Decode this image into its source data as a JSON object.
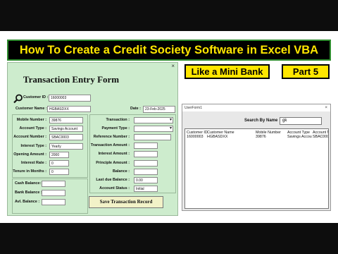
{
  "banner": {
    "title": "How To Create a Credit Society Software in Excel VBA"
  },
  "badges": {
    "mini_bank": "Like a Mini Bank",
    "part": "Part  5"
  },
  "form": {
    "title": "Transaction Entry Form",
    "close": "×",
    "customer_id_label": "Customer ID :",
    "customer_id_value": "16000003",
    "customer_name_label": "Customer Name :",
    "customer_name_value": "HGBASDXX",
    "date_label": "Date :",
    "date_value": "23-Feb-2025",
    "left_fields": [
      {
        "label": "Mobile Number :",
        "value": "39876"
      },
      {
        "label": "Account Type :",
        "value": "Savings Account"
      },
      {
        "label": "Account Number :",
        "value": "SBAC0003"
      },
      {
        "label": "Interest Type :",
        "value": "Yearly"
      },
      {
        "label": "Opening Amount :",
        "value": "2000"
      },
      {
        "label": "Interest Rate :",
        "value": "0"
      },
      {
        "label": "Tenure in Months :",
        "value": "0"
      }
    ],
    "balances": [
      {
        "label": "Cash Balance:",
        "value": ""
      },
      {
        "label": "Bank Balance :",
        "value": ""
      },
      {
        "label": "Avl. Balance :",
        "value": ""
      }
    ],
    "right_fields": [
      {
        "label": "Transaction :",
        "value": ""
      },
      {
        "label": "Payment Type :",
        "value": ""
      },
      {
        "label": "Reference Number :",
        "value": ""
      },
      {
        "label": "Transaction Amount :",
        "value": ""
      },
      {
        "label": "Interest Amount :",
        "value": ""
      },
      {
        "label": "Principle Amount :",
        "value": ""
      },
      {
        "label": "Balance :",
        "value": ""
      },
      {
        "label": "Last due Balance :",
        "value": "0.00"
      },
      {
        "label": "Account Status :",
        "value": "Initial"
      }
    ],
    "save_button": "Save Transaction Record"
  },
  "userform": {
    "title": "UserForm1",
    "close": "×",
    "search_label": "Search By Name",
    "search_value": "gk",
    "columns": [
      "Customer ID",
      "Customer Name",
      "Mobile Number",
      "Account Type",
      "Account N"
    ],
    "rows": [
      [
        "16000003",
        "HGBASDXX",
        "39876",
        "Savings Accou",
        "SBAC0003"
      ]
    ]
  },
  "colors": {
    "banner_text": "#ffe600",
    "form_bg": "#cdeccd",
    "banner_border": "#2e8b2e"
  },
  "icons": {
    "search": "magnifier-icon"
  }
}
